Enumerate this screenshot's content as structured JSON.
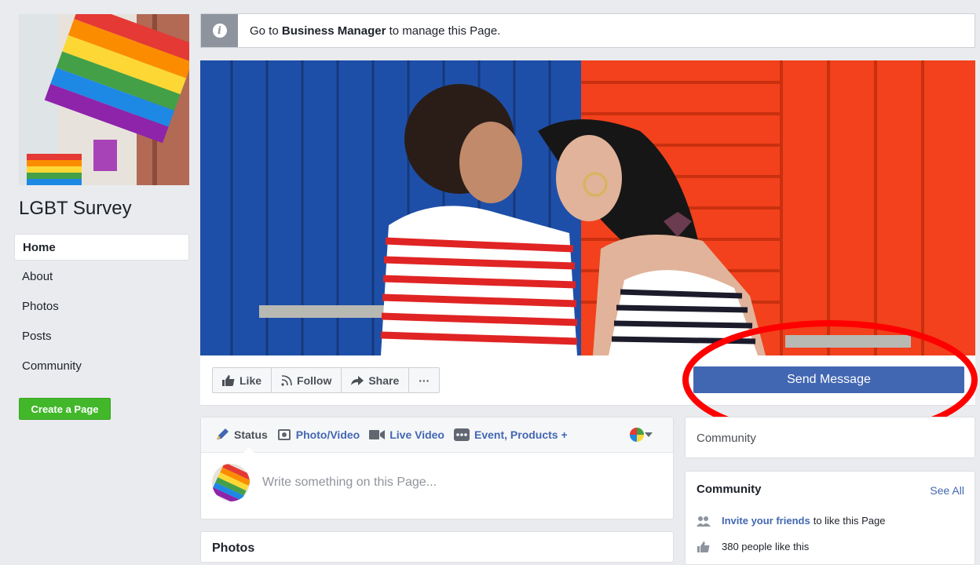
{
  "page": {
    "name": "LGBT Survey"
  },
  "nav": {
    "items": [
      {
        "label": "Home",
        "active": true
      },
      {
        "label": "About"
      },
      {
        "label": "Photos"
      },
      {
        "label": "Posts"
      },
      {
        "label": "Community"
      }
    ],
    "create_page_label": "Create a Page"
  },
  "info_bar": {
    "prefix": "Go to ",
    "link": "Business Manager",
    "suffix": " to manage this Page."
  },
  "actions": {
    "like": "Like",
    "follow": "Follow",
    "share": "Share",
    "more": "···",
    "send_message": "Send Message"
  },
  "composer": {
    "tabs": [
      "Status",
      "Photo/Video",
      "Live Video",
      "Event, Products +"
    ],
    "placeholder": "Write something on this Page..."
  },
  "photos": {
    "title": "Photos"
  },
  "right": {
    "community_tab": "Community",
    "community_card": {
      "title": "Community",
      "see_all": "See All",
      "invite_link": "Invite your friends",
      "invite_rest": "to like this Page",
      "likes_text": "380 people like this"
    }
  },
  "colors": {
    "brand_blue": "#4267b2",
    "create_green": "#42b72a",
    "annotation_red": "#ff0000",
    "background": "#e9ebee"
  },
  "icons": {
    "info": "info-icon",
    "like": "thumbs-up-icon",
    "follow": "rss-icon",
    "share": "share-arrow-icon",
    "status": "pencil-icon",
    "photo": "camera-icon",
    "live": "video-camera-icon",
    "event": "ellipsis-box-icon",
    "audience": "rainbow-avatar-icon",
    "invite": "friends-icon",
    "likes": "thumbs-up-icon"
  }
}
